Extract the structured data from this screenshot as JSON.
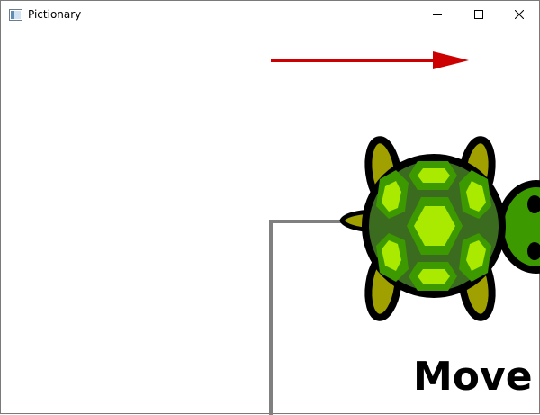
{
  "window": {
    "title": "Pictionary",
    "buttons": {
      "minimize": "minimize",
      "maximize": "maximize",
      "close": "close"
    }
  },
  "canvas": {
    "label": "Move",
    "arrow_color": "#cc0000",
    "path_color": "#808080",
    "turtle": {
      "shell_dark": "#3a6b1e",
      "shell_mid": "#3c9a00",
      "shell_light": "#aaea00",
      "limb_color": "#a0a000",
      "head_color": "#3c9a00",
      "outline": "#000000"
    }
  }
}
